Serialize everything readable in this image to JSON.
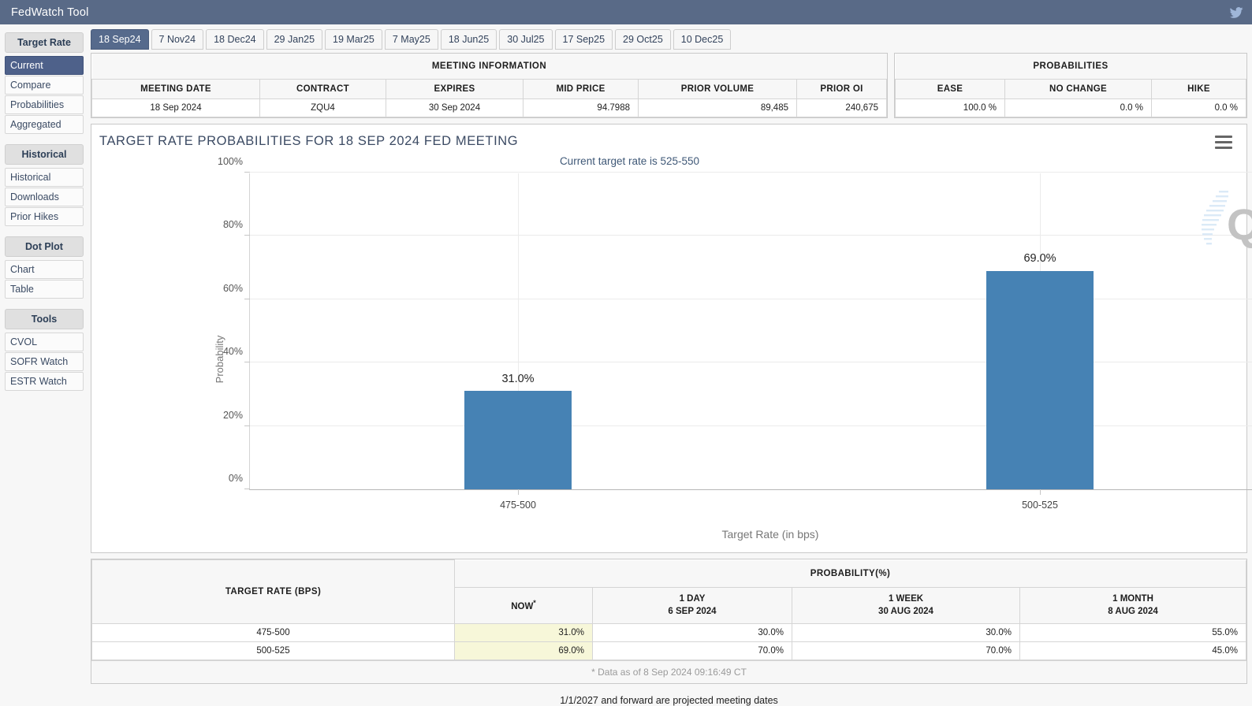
{
  "titlebar": {
    "title": "FedWatch Tool",
    "twitter_icon": "twitter-bird-icon"
  },
  "sidebar": {
    "groups": [
      {
        "heading": "Target Rate",
        "items": [
          {
            "label": "Current",
            "active": true
          },
          {
            "label": "Compare",
            "active": false
          },
          {
            "label": "Probabilities",
            "active": false
          },
          {
            "label": "Aggregated",
            "active": false
          }
        ]
      },
      {
        "heading": "Historical",
        "items": [
          {
            "label": "Historical",
            "active": false
          },
          {
            "label": "Downloads",
            "active": false
          },
          {
            "label": "Prior Hikes",
            "active": false
          }
        ]
      },
      {
        "heading": "Dot Plot",
        "items": [
          {
            "label": "Chart",
            "active": false
          },
          {
            "label": "Table",
            "active": false
          }
        ]
      },
      {
        "heading": "Tools",
        "items": [
          {
            "label": "CVOL",
            "active": false
          },
          {
            "label": "SOFR Watch",
            "active": false
          },
          {
            "label": "ESTR Watch",
            "active": false
          }
        ]
      }
    ]
  },
  "tabs": [
    {
      "label": "18 Sep24",
      "active": true
    },
    {
      "label": "7 Nov24",
      "active": false
    },
    {
      "label": "18 Dec24",
      "active": false
    },
    {
      "label": "29 Jan25",
      "active": false
    },
    {
      "label": "19 Mar25",
      "active": false
    },
    {
      "label": "7 May25",
      "active": false
    },
    {
      "label": "18 Jun25",
      "active": false
    },
    {
      "label": "30 Jul25",
      "active": false
    },
    {
      "label": "17 Sep25",
      "active": false
    },
    {
      "label": "29 Oct25",
      "active": false
    },
    {
      "label": "10 Dec25",
      "active": false
    }
  ],
  "meeting_information": {
    "span_header": "MEETING INFORMATION",
    "columns": [
      "MEETING DATE",
      "CONTRACT",
      "EXPIRES",
      "MID PRICE",
      "PRIOR VOLUME",
      "PRIOR OI"
    ],
    "row": {
      "meeting_date": "18 Sep 2024",
      "contract": "ZQU4",
      "expires": "30 Sep 2024",
      "mid_price": "94.7988",
      "prior_volume": "89,485",
      "prior_oi": "240,675"
    }
  },
  "probabilities_panel": {
    "span_header": "PROBABILITIES",
    "columns": [
      "EASE",
      "NO CHANGE",
      "HIKE"
    ],
    "row": {
      "ease": "100.0 %",
      "no_change": "0.0 %",
      "hike": "0.0 %"
    }
  },
  "chart_panel": {
    "menu_icon": "hamburger-menu-icon",
    "watermark": "quikstrike-q-logo"
  },
  "chart_data": {
    "type": "bar",
    "title": "TARGET RATE PROBABILITIES FOR 18 SEP 2024 FED MEETING",
    "subtitle": "Current target rate is 525-550",
    "xlabel": "Target Rate (in bps)",
    "ylabel": "Probability",
    "categories": [
      "475-500",
      "500-525"
    ],
    "values": [
      31.0,
      69.0
    ],
    "data_labels": [
      "31.0%",
      "69.0%"
    ],
    "ylim": [
      0,
      100
    ],
    "yticks": [
      0,
      20,
      40,
      60,
      80,
      100
    ],
    "ytick_labels": [
      "0%",
      "20%",
      "40%",
      "60%",
      "80%",
      "100%"
    ],
    "grid": true,
    "legend": "none",
    "bar_color": "#4682b4"
  },
  "bottom_table": {
    "target_rate_header": "TARGET RATE (BPS)",
    "probability_header": "PROBABILITY(%)",
    "columns": [
      {
        "line1": "NOW",
        "line2": "",
        "star": true
      },
      {
        "line1": "1 DAY",
        "line2": "6 SEP 2024",
        "star": false
      },
      {
        "line1": "1 WEEK",
        "line2": "30 AUG 2024",
        "star": false
      },
      {
        "line1": "1 MONTH",
        "line2": "8 AUG 2024",
        "star": false
      }
    ],
    "rows": [
      {
        "rate": "475-500",
        "now": "31.0%",
        "day1": "30.0%",
        "week1": "30.0%",
        "month1": "55.0%"
      },
      {
        "rate": "500-525",
        "now": "69.0%",
        "day1": "70.0%",
        "week1": "70.0%",
        "month1": "45.0%"
      }
    ],
    "as_of": "* Data as of 8 Sep 2024 09:16:49 CT"
  },
  "footer": {
    "note": "1/1/2027 and forward are projected meeting dates"
  }
}
